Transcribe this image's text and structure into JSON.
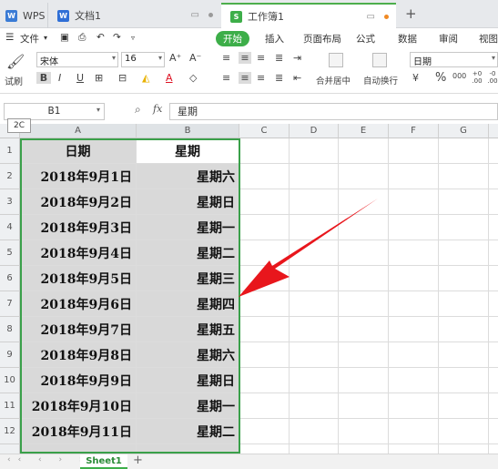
{
  "tabs": {
    "wps": "WPS",
    "doc": "文档1",
    "book": "工作簿1",
    "add": "+"
  },
  "menu": {
    "file": "文件",
    "items": [
      "开始",
      "插入",
      "页面布局",
      "公式",
      "数据",
      "审阅",
      "视图"
    ]
  },
  "ribbon": {
    "font_name": "宋体",
    "font_size": "16",
    "merge_label": "合并居中",
    "wrap_label": "自动换行",
    "number_format": "日期",
    "brush_label": "试刷",
    "bold": "B",
    "italic": "I",
    "underline": "U",
    "inc_font": "A⁺",
    "dec_font": "A⁻",
    "percent": "%",
    "thousands": "000",
    "dec_inc": "+0 .00",
    "dec_dec": "-0 .00"
  },
  "formula_bar": {
    "name_box": "B1",
    "fx": "fx",
    "content": "星期"
  },
  "tooltip": "2C",
  "columns": [
    "A",
    "B",
    "C",
    "D",
    "E",
    "F",
    "G"
  ],
  "rows": [
    {
      "num": "1",
      "a": "日期",
      "b": "星期"
    },
    {
      "num": "2",
      "a": "2018年9月1日",
      "b": "星期六"
    },
    {
      "num": "3",
      "a": "2018年9月2日",
      "b": "星期日"
    },
    {
      "num": "4",
      "a": "2018年9月3日",
      "b": "星期一"
    },
    {
      "num": "5",
      "a": "2018年9月4日",
      "b": "星期二"
    },
    {
      "num": "6",
      "a": "2018年9月5日",
      "b": "星期三"
    },
    {
      "num": "7",
      "a": "2018年9月6日",
      "b": "星期四"
    },
    {
      "num": "8",
      "a": "2018年9月7日",
      "b": "星期五"
    },
    {
      "num": "9",
      "a": "2018年9月8日",
      "b": "星期六"
    },
    {
      "num": "10",
      "a": "2018年9月9日",
      "b": "星期日"
    },
    {
      "num": "11",
      "a": "2018年9月10日",
      "b": "星期一"
    },
    {
      "num": "12",
      "a": "2018年9月11日",
      "b": "星期二"
    }
  ],
  "status": {
    "sheet_name": "Sheet1",
    "add_sheet": "+"
  },
  "colors": {
    "accent_green": "#3dae49",
    "selection_fill": "#d9d9d9",
    "annotation_arrow": "#e8161c"
  }
}
